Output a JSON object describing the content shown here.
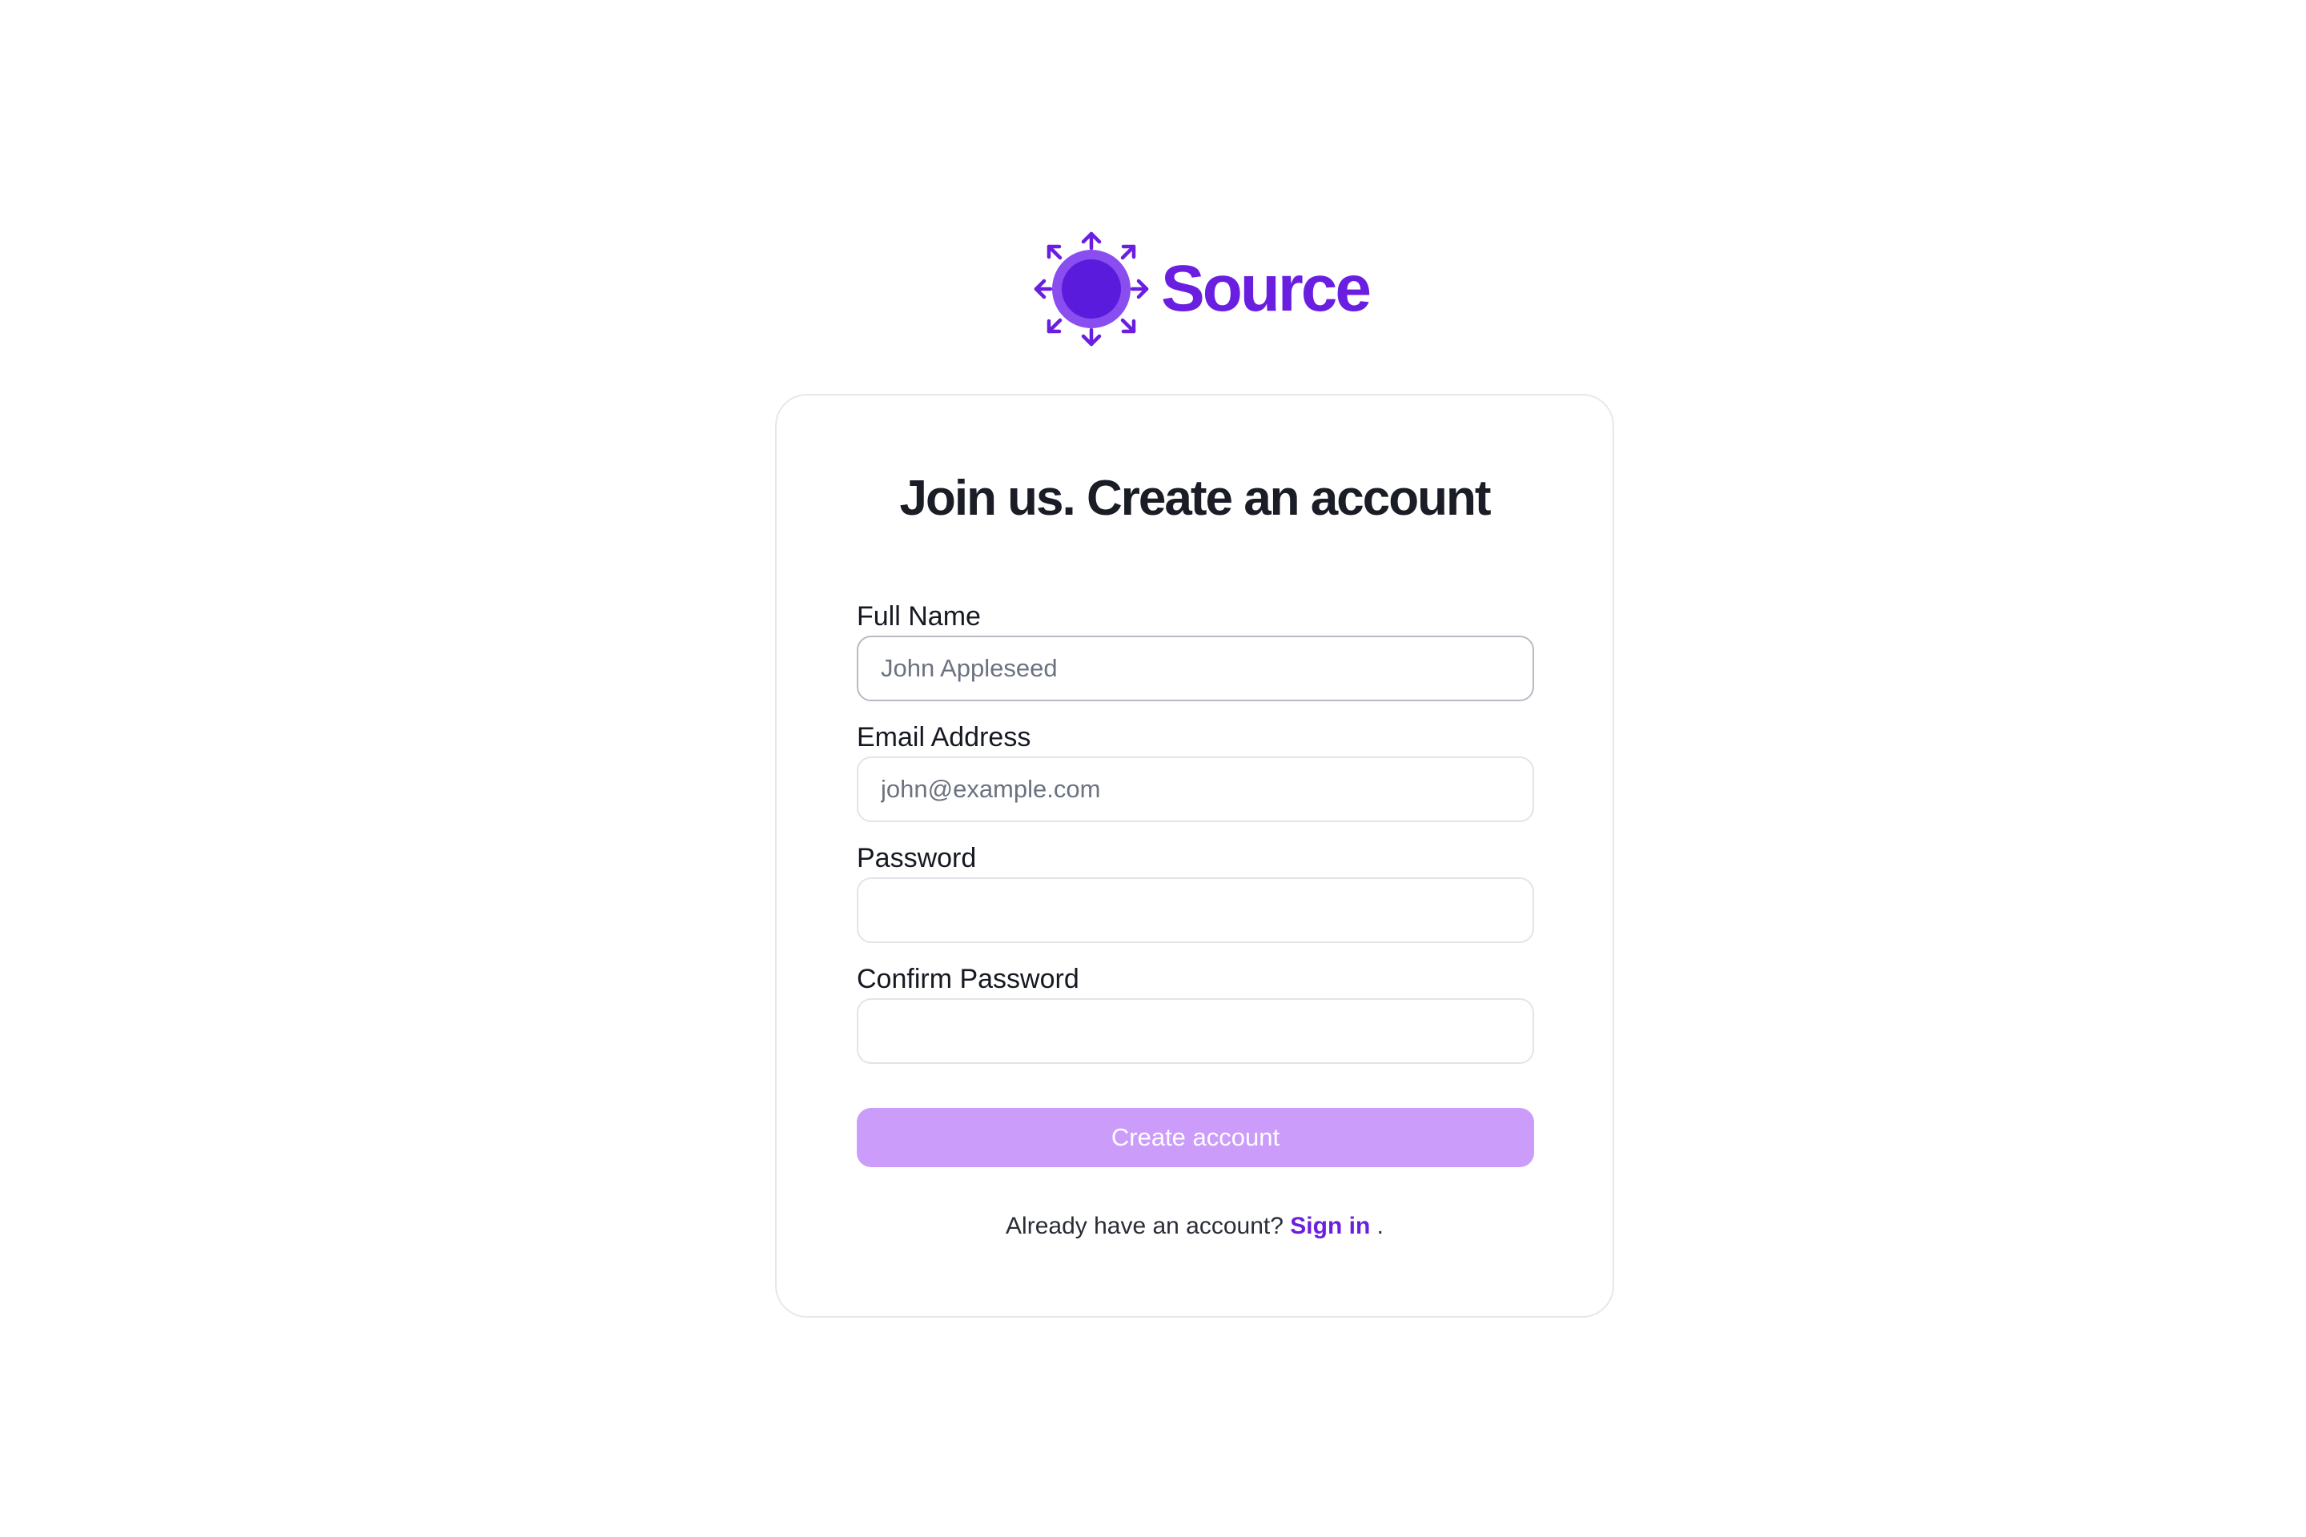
{
  "brand": {
    "name": "Source",
    "color": "#6a1fe0",
    "icon": "radiating-circle-logo-icon"
  },
  "form": {
    "title": "Join us. Create an account",
    "fields": [
      {
        "label": "Full Name",
        "placeholder": "John Appleseed",
        "value": "",
        "type": "text",
        "focused": true
      },
      {
        "label": "Email Address",
        "placeholder": "john@example.com",
        "value": "",
        "type": "email",
        "focused": false
      },
      {
        "label": "Password",
        "placeholder": "",
        "value": "",
        "type": "password",
        "focused": false
      },
      {
        "label": "Confirm Password",
        "placeholder": "",
        "value": "",
        "type": "password",
        "focused": false
      }
    ],
    "submit_label": "Create account",
    "submit_color": "#cc9cfb",
    "signin_prompt": "Already have an account?",
    "signin_link": "Sign in",
    "signin_suffix": "."
  }
}
